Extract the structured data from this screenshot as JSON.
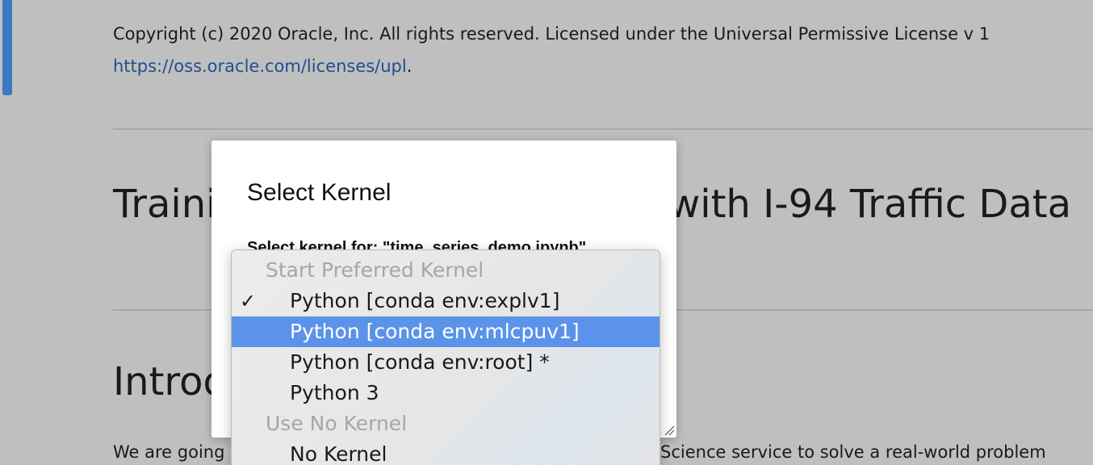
{
  "notebook": {
    "copyright": "Copyright (c) 2020 Oracle, Inc. All rights reserved. Licensed under the Universal Permissive License v 1",
    "license_link": "https://oss.oracle.com/licenses/upl",
    "license_period": ".",
    "heading_left": "Traini",
    "heading_right": "with I-94 Traffic Data",
    "intro_heading": "Introd",
    "body_left": "We are going",
    "body_right": "Science service to solve a real-world problem"
  },
  "modal": {
    "title": "Select Kernel",
    "subtitle": "Select kernel for: \"time_series_demo.ipynb\""
  },
  "dropdown": {
    "groups": [
      {
        "label": "Start Preferred Kernel",
        "items": [
          {
            "label": "Python [conda env:explv1]",
            "checked": true,
            "selected": false
          },
          {
            "label": "Python [conda env:mlcpuv1]",
            "checked": false,
            "selected": true
          },
          {
            "label": "Python [conda env:root] *",
            "checked": false,
            "selected": false
          },
          {
            "label": "Python 3",
            "checked": false,
            "selected": false
          }
        ]
      },
      {
        "label": "Use No Kernel",
        "items": [
          {
            "label": "No Kernel",
            "checked": false,
            "selected": false
          }
        ]
      }
    ],
    "check_icon": "checkmark-icon"
  },
  "colors": {
    "overlay_bg": "#bfbfbf",
    "cell_marker": "#3a7ac4",
    "link": "#1f4f8f",
    "selection": "#5b93ea"
  }
}
